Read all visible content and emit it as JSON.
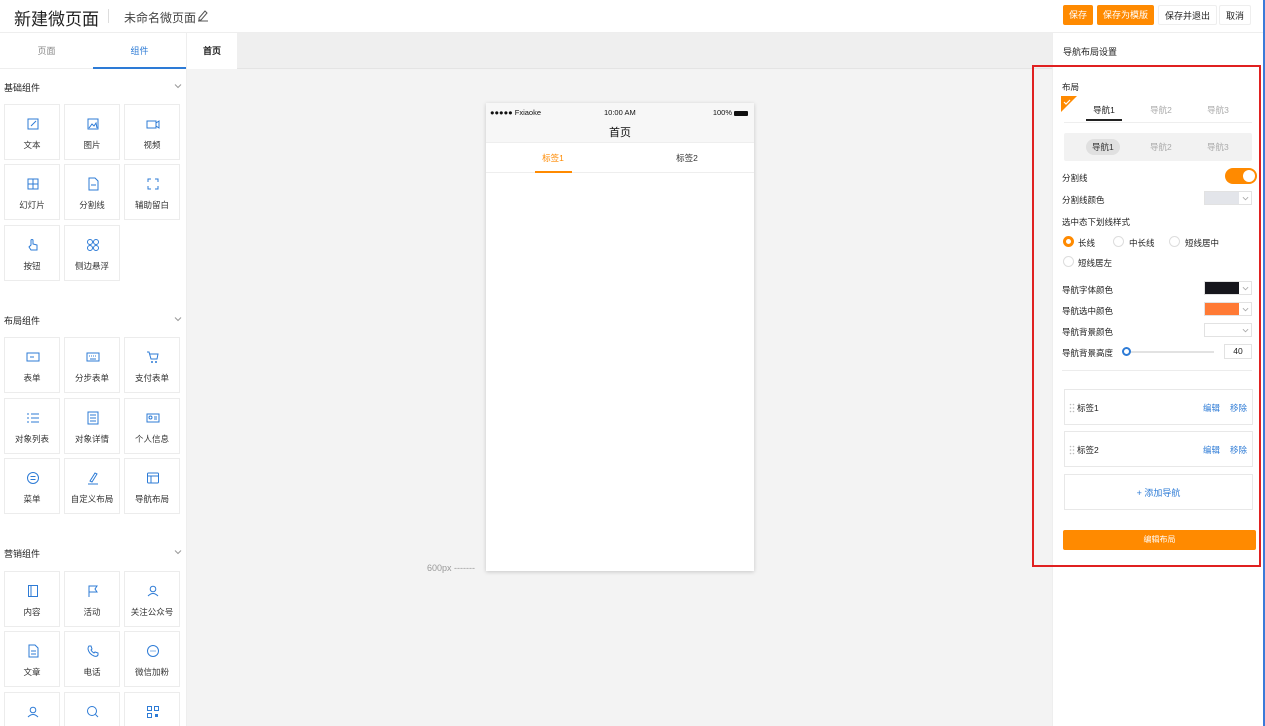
{
  "header": {
    "title": "新建微页面",
    "subtitle": "未命名微页面",
    "buttons": {
      "save": "保存",
      "save_template": "保存为模版",
      "save_exit": "保存并退出",
      "cancel": "取消"
    }
  },
  "left": {
    "tabs": [
      "页面",
      "组件"
    ],
    "sections": [
      {
        "title": "基础组件",
        "items": [
          "文本",
          "图片",
          "视频",
          "幻灯片",
          "分割线",
          "辅助留白",
          "按钮",
          "侧边悬浮"
        ]
      },
      {
        "title": "布局组件",
        "items": [
          "表单",
          "分步表单",
          "支付表单",
          "对象列表",
          "对象详情",
          "个人信息",
          "菜单",
          "自定义布局",
          "导航布局"
        ]
      },
      {
        "title": "营销组件",
        "items": [
          "内容",
          "活动",
          "关注公众号",
          "文章",
          "电话",
          "微信加粉"
        ]
      }
    ]
  },
  "canvas": {
    "tab": "首页",
    "ruler": "600px",
    "phone": {
      "carrier": "●●●●● Fxiaoke",
      "time": "10:00 AM",
      "battery": "100%",
      "title": "首页",
      "tabs": [
        "标签1",
        "标签2"
      ]
    }
  },
  "right": {
    "title": "导航布局设置",
    "layout_label": "布局",
    "nav_options": [
      "导航1",
      "导航2",
      "导航3"
    ],
    "pill_options": [
      "导航1",
      "导航2",
      "导航3"
    ],
    "divider_label": "分割线",
    "divider_color_label": "分割线颜色",
    "underline_style_label": "选中态下划线样式",
    "underline_options": [
      "长线",
      "中长线",
      "短线居中",
      "短线居左"
    ],
    "font_color_label": "导航字体颜色",
    "selected_color_label": "导航选中颜色",
    "bg_color_label": "导航背景颜色",
    "bg_height_label": "导航背景高度",
    "bg_height_value": "40",
    "bg_height_fraction": 0,
    "divider_on": true,
    "colors": {
      "divider": "#e3e5ea",
      "font": "#16161c",
      "selected": "#ff7a35",
      "bg": "#ffffff",
      "accent": "#ff8a00",
      "link": "#2d7bd6"
    },
    "tab_items": [
      "标签1",
      "标签2"
    ],
    "edit_action": "编辑",
    "remove_action": "移除",
    "add_nav": "+ 添加导航",
    "edit_layout": "编辑布局"
  }
}
